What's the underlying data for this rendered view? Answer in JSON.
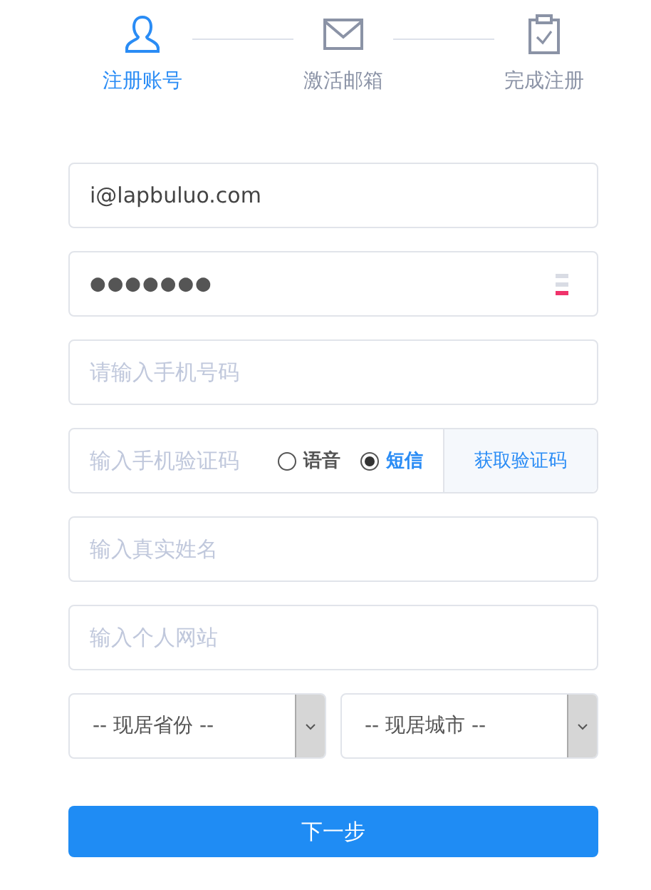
{
  "steps": [
    {
      "label": "注册账号",
      "kind": "user",
      "selected": true
    },
    {
      "label": "激活邮箱",
      "kind": "mail",
      "selected": false
    },
    {
      "label": "完成注册",
      "kind": "clipboard",
      "selected": false
    }
  ],
  "email": {
    "value": "i@lapbuluo.com"
  },
  "password": {
    "value": "●●●●●●●",
    "strength": {
      "level": 0.33
    }
  },
  "phone": {
    "placeholder": "请输入手机号码"
  },
  "code": {
    "placeholder": "输入手机验证码",
    "options": [
      {
        "label": "语音",
        "selected": false
      },
      {
        "label": "短信",
        "selected": true
      }
    ],
    "button": "获取验证码"
  },
  "name": {
    "placeholder": "输入真实姓名"
  },
  "website": {
    "placeholder": "输入个人网站"
  },
  "selects": [
    {
      "value": "-- 现居省份 --"
    },
    {
      "value": "-- 现居城市 --"
    }
  ],
  "submit": "下一步"
}
